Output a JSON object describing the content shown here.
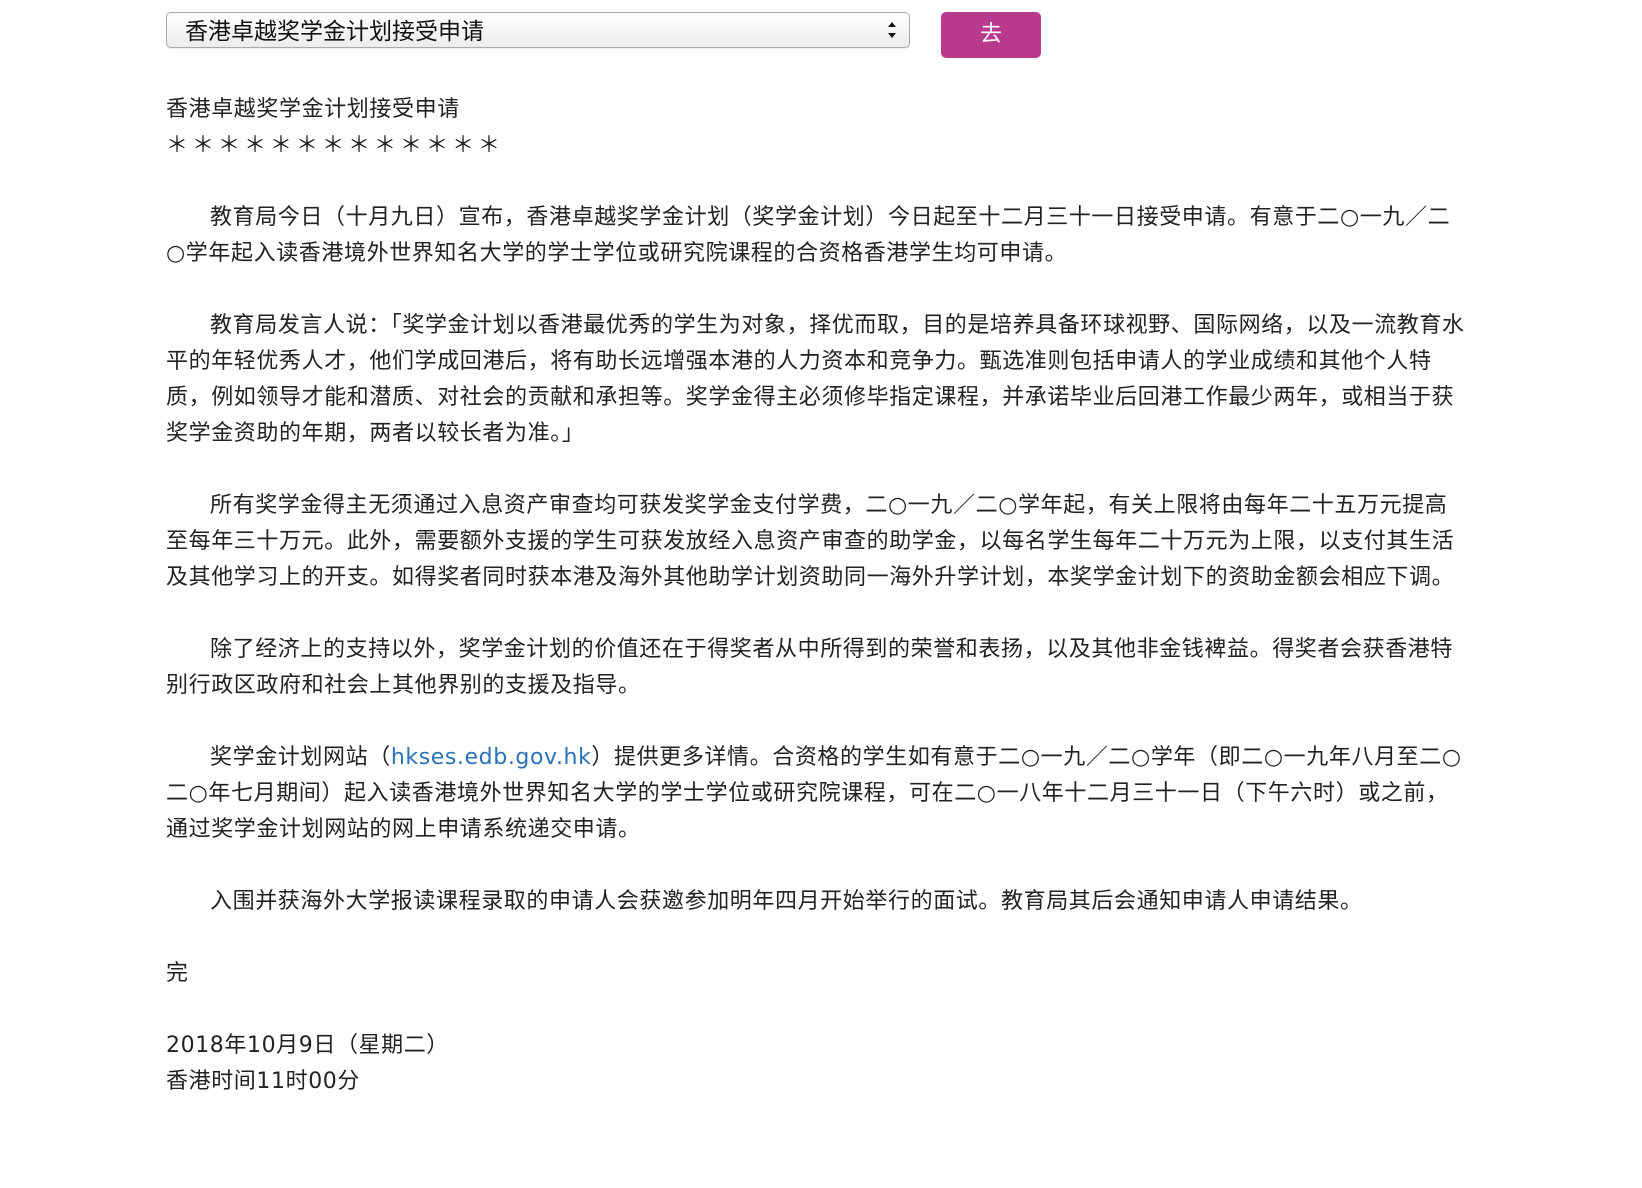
{
  "selector": {
    "selected": "香港卓越奖学金计划接受申请",
    "go_label": "去"
  },
  "article": {
    "title": "香港卓越奖学金计划接受申请",
    "stars": "＊＊＊＊＊＊＊＊＊＊＊＊＊",
    "paragraphs": [
      "教育局今日（十月九日）宣布，香港卓越奖学金计划（奖学金计划）今日起至十二月三十一日接受申请。有意于二○一九／二○学年起入读香港境外世界知名大学的学士学位或研究院课程的合资格香港学生均可申请。",
      "教育局发言人说：「奖学金计划以香港最优秀的学生为对象，择优而取，目的是培养具备环球视野、国际网络，以及一流教育水平的年轻优秀人才，他们学成回港后，将有助长远增强本港的人力资本和竞争力。甄选准则包括申请人的学业成绩和其他个人特质，例如领导才能和潜质、对社会的贡献和承担等。奖学金得主必须修毕指定课程，并承诺毕业后回港工作最少两年，或相当于获奖学金资助的年期，两者以较长者为准。」",
      "所有奖学金得主无须通过入息资产审查均可获发奖学金支付学费，二○一九／二○学年起，有关上限将由每年二十五万元提高至每年三十万元。此外，需要额外支援的学生可获发放经入息资产审查的助学金，以每名学生每年二十万元为上限，以支付其生活及其他学习上的开支。如得奖者同时获本港及海外其他助学计划资助同一海外升学计划，本奖学金计划下的资助金额会相应下调。",
      "除了经济上的支持以外，奖学金计划的价值还在于得奖者从中所得到的荣誉和表扬，以及其他非金钱裨益。得奖者会获香港特别行政区政府和社会上其他界别的支援及指导。"
    ],
    "website_para": {
      "before": "奖学金计划网站（",
      "link_text": "hkses.edb.gov.hk",
      "after": "）提供更多详情。合资格的学生如有意于二○一九／二○学年（即二○一九年八月至二○二○年七月期间）起入读香港境外世界知名大学的学士学位或研究院课程，可在二○一八年十二月三十一日（下午六时）或之前，通过奖学金计划网站的网上申请系统递交申请。"
    },
    "last_para": "入围并获海外大学报读课程录取的申请人会获邀参加明年四月开始举行的面试。教育局其后会通知申请人申请结果。",
    "ending": "完",
    "date": "2018年10月9日（星期二）",
    "time": "香港时间11时00分"
  },
  "colors": {
    "button": "#b93a8c",
    "link": "#2a72b8"
  },
  "icons": {
    "select_arrows": "up-down-chevron-icon"
  }
}
